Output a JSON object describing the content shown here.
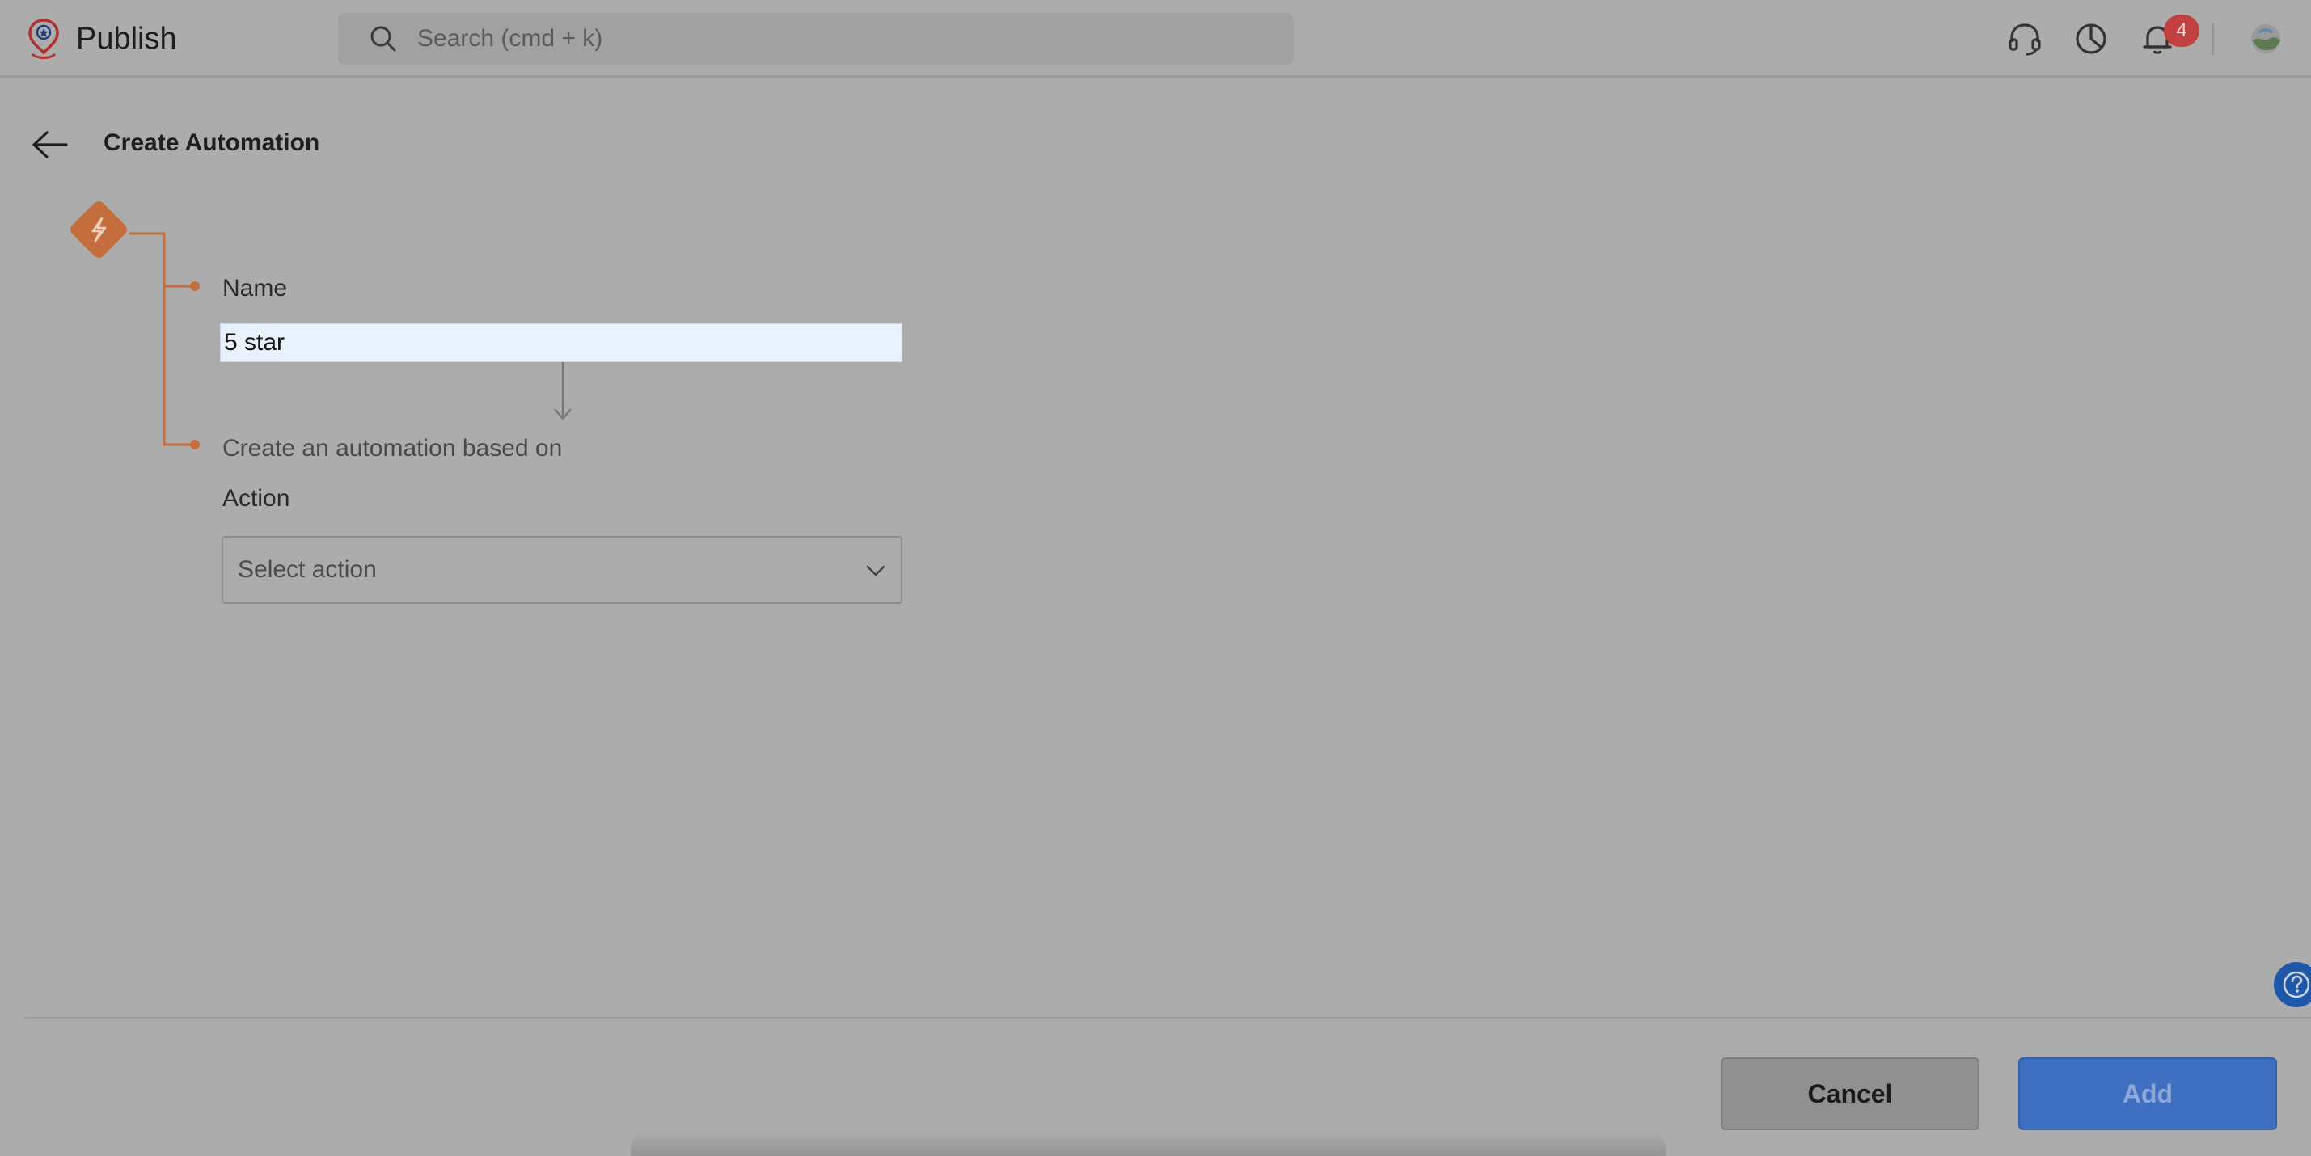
{
  "app": {
    "name": "Publish"
  },
  "search": {
    "placeholder": "Search (cmd + k)"
  },
  "notifications": {
    "count": "4"
  },
  "page": {
    "title": "Create Automation"
  },
  "form": {
    "name_label": "Name",
    "name_value": "5 star",
    "based_on_label": "Create an automation based on",
    "action_label": "Action",
    "action_placeholder": "Select action"
  },
  "footer": {
    "cancel_label": "Cancel",
    "add_label": "Add"
  },
  "icons": {
    "logo": "map-pin-star-icon",
    "search": "search-icon",
    "support": "headset-icon",
    "reports": "pie-chart-icon",
    "notifications": "bell-icon",
    "trigger": "lightning-bolt-icon",
    "back": "arrow-left-icon",
    "help": "question-circle-icon"
  },
  "colors": {
    "accent_orange": "#c46e3d",
    "primary_blue": "#3f6fc1",
    "badge_red": "#c14141",
    "input_bg": "#e9f0fe"
  }
}
